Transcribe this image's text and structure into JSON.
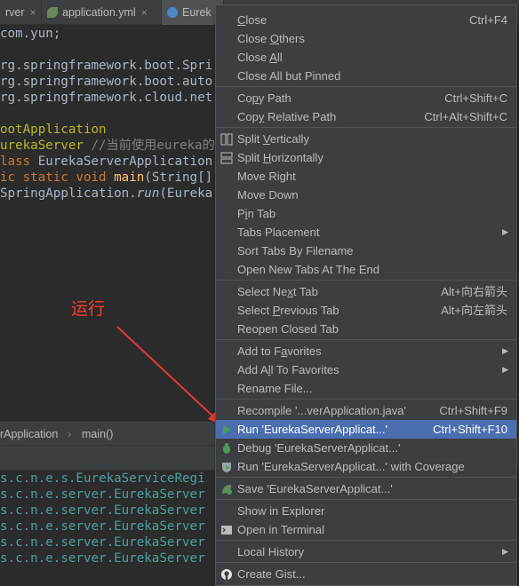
{
  "tabs": [
    {
      "label": "rver"
    },
    {
      "label": "application.yml"
    },
    {
      "label": "Eurek"
    }
  ],
  "code_lines": [
    {
      "parts": [
        {
          "t": "com.yun;",
          "c": "plain"
        }
      ]
    },
    {
      "parts": [
        {
          "t": "rg.springframework.boot.Spri",
          "c": "plain"
        }
      ]
    },
    {
      "parts": [
        {
          "t": "rg.springframework.boot.auto",
          "c": "plain"
        }
      ]
    },
    {
      "parts": [
        {
          "t": "rg.springframework.cloud.net",
          "c": "plain"
        }
      ]
    },
    {
      "parts": [
        {
          "t": "ootApplication",
          "c": "ann"
        }
      ]
    },
    {
      "parts": [
        {
          "t": "urekaServer ",
          "c": "ann"
        },
        {
          "t": "//当前使用eureka的",
          "c": "cmt"
        }
      ]
    },
    {
      "parts": [
        {
          "t": "lass ",
          "c": "kw"
        },
        {
          "t": "EurekaServerApplication",
          "c": "plain"
        }
      ]
    },
    {
      "parts": [
        {
          "t": "ic static void ",
          "c": "kw"
        },
        {
          "t": "main",
          "c": "method"
        },
        {
          "t": "(String[]",
          "c": "plain"
        }
      ]
    },
    {
      "parts": [
        {
          "t": "SpringApplication.",
          "c": "plain"
        },
        {
          "t": "run",
          "c": "plain italic"
        },
        {
          "t": "(Eureka",
          "c": "plain"
        }
      ]
    }
  ],
  "annotation": "运行",
  "breadcrumb": {
    "first": "rApplication",
    "second": "main()"
  },
  "console_lines": [
    "s.c.n.e.s.EurekaServiceRegi",
    "s.c.n.e.server.EurekaServer",
    "s.c.n.e.server.EurekaServer",
    "s.c.n.e.server.EurekaServer",
    "s.c.n.e.server.EurekaServer",
    "s.c.n.e.server.EurekaServer"
  ],
  "menu": {
    "close": {
      "pre": "",
      "u": "C",
      "post": "lose",
      "shortcut": "Ctrl+F4"
    },
    "close_others": {
      "pre": "Close ",
      "u": "O",
      "post": "thers"
    },
    "close_all": {
      "pre": "Close ",
      "u": "A",
      "post": "ll"
    },
    "close_all_but_pinned": {
      "label": "Close All but Pinned"
    },
    "copy_path": {
      "pre": "Co",
      "u": "p",
      "post": "y Path",
      "shortcut": "Ctrl+Shift+C"
    },
    "copy_relative_path": {
      "pre": "Cop",
      "u": "y",
      "post": " Relative Path",
      "shortcut": "Ctrl+Alt+Shift+C"
    },
    "split_vertically": {
      "pre": "Split ",
      "u": "V",
      "post": "ertically"
    },
    "split_horizontally": {
      "pre": "Split ",
      "u": "H",
      "post": "orizontally"
    },
    "move_right": {
      "label": "Move Right"
    },
    "move_down": {
      "label": "Move Down"
    },
    "pin_tab": {
      "pre": "P",
      "u": "i",
      "post": "n Tab"
    },
    "tabs_placement": {
      "label": "Tabs Placement"
    },
    "sort_tabs": {
      "label": "Sort Tabs By Filename"
    },
    "open_new_tabs": {
      "label": "Open New Tabs At The End"
    },
    "select_next_tab": {
      "pre": "Select Ne",
      "u": "x",
      "post": "t Tab",
      "shortcut": "Alt+向右箭头"
    },
    "select_previous_tab": {
      "pre": "Select ",
      "u": "P",
      "post": "revious Tab",
      "shortcut": "Alt+向左箭头"
    },
    "reopen_closed_tab": {
      "label": "Reopen Closed Tab"
    },
    "add_to_favorites": {
      "pre": "Add to F",
      "u": "a",
      "post": "vorites"
    },
    "add_all_to_favorites": {
      "pre": "Add A",
      "u": "l",
      "post": "l To Favorites"
    },
    "rename_file": {
      "label": "Rename File..."
    },
    "recompile": {
      "label": "Recompile '...verApplication.java'",
      "shortcut": "Ctrl+Shift+F9"
    },
    "run": {
      "label": "Run 'EurekaServerApplicat...'",
      "shortcut": "Ctrl+Shift+F10"
    },
    "debug": {
      "label": "Debug 'EurekaServerApplicat...'"
    },
    "run_coverage": {
      "label": "Run 'EurekaServerApplicat...' with Coverage"
    },
    "save": {
      "label": "Save 'EurekaServerApplicat...'"
    },
    "show_in_explorer": {
      "label": "Show in Explorer"
    },
    "open_in_terminal": {
      "label": "Open in Terminal"
    },
    "local_history": {
      "label": "Local History"
    },
    "create_gist": {
      "label": "Create Gist..."
    }
  },
  "colors": {
    "highlight": "#4b6eaf",
    "menu_bg": "#3c3f41",
    "annotation": "#ff3b30",
    "run_green": "#499c54"
  }
}
